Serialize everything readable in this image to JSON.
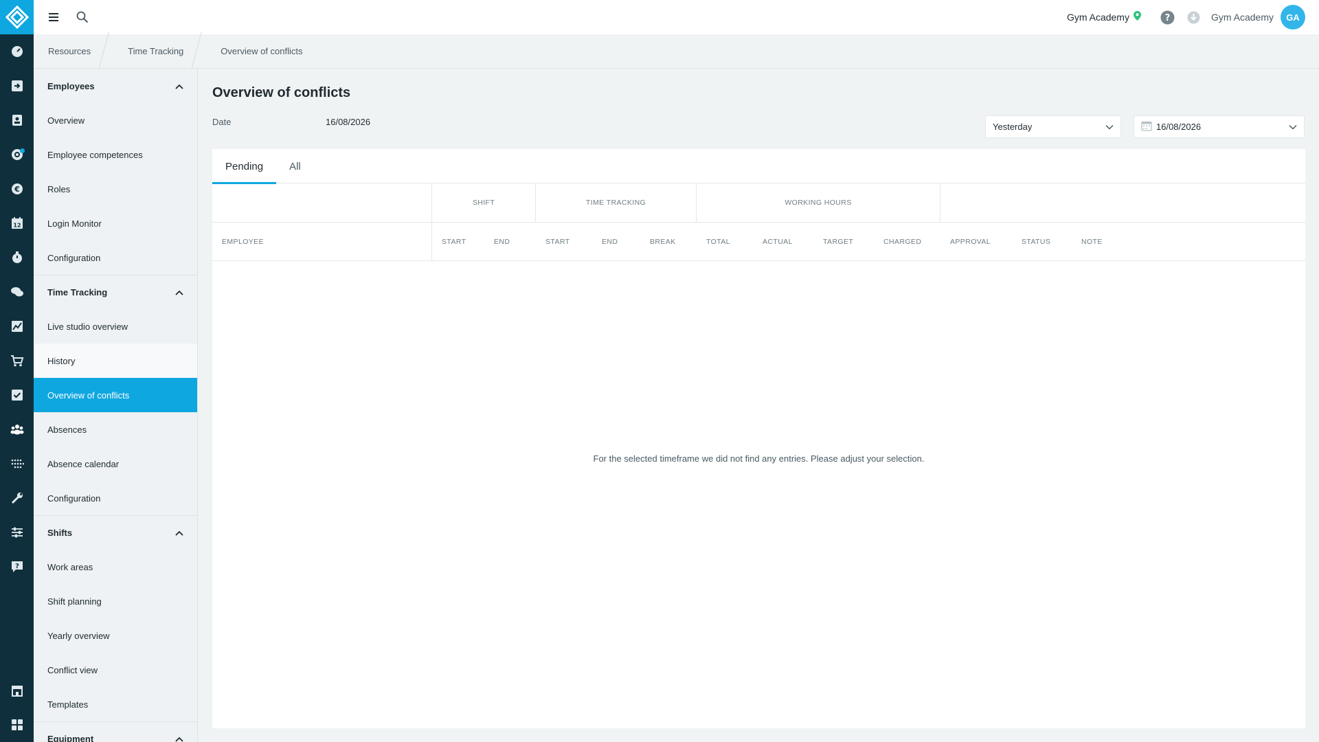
{
  "topbar": {
    "studio": "Gym Academy",
    "user_name": "Gym Academy",
    "avatar_initials": "GA"
  },
  "breadcrumb": [
    "Resources",
    "Time Tracking",
    "Overview of conflicts"
  ],
  "sidebar": {
    "sections": [
      {
        "title": "Employees",
        "items": [
          "Overview",
          "Employee competences",
          "Roles",
          "Login Monitor",
          "Configuration"
        ]
      },
      {
        "title": "Time Tracking",
        "items": [
          "Live studio overview",
          "History",
          "Overview of conflicts",
          "Absences",
          "Absence calendar",
          "Configuration"
        ]
      },
      {
        "title": "Shifts",
        "items": [
          "Work areas",
          "Shift planning",
          "Yearly overview",
          "Conflict view",
          "Templates"
        ]
      },
      {
        "title": "Equipment",
        "items": []
      }
    ],
    "active_item": "Overview of conflicts",
    "hover_item": "History"
  },
  "page": {
    "title": "Overview of conflicts",
    "date_label": "Date",
    "date_value": "16/08/2026",
    "range_select": "Yesterday",
    "date_picker": "16/08/2026"
  },
  "tabs": [
    "Pending",
    "All"
  ],
  "active_tab": "Pending",
  "table": {
    "groups": [
      "",
      "SHIFT",
      "TIME TRACKING",
      "WORKING HOURS",
      ""
    ],
    "columns": {
      "employee": "EMPLOYEE",
      "shift": [
        "START",
        "END"
      ],
      "time_tracking": [
        "START",
        "END",
        "BREAK"
      ],
      "working_hours": [
        "TOTAL",
        "ACTUAL",
        "TARGET",
        "CHARGED"
      ],
      "rest": [
        "APPROVAL",
        "STATUS",
        "NOTE"
      ]
    },
    "empty_message": "For the selected timeframe we did not find any entries. Please adjust your selection."
  },
  "colors": {
    "accent": "#0fa7e0",
    "rail": "#102f3d",
    "pin": "#2ec27e"
  }
}
